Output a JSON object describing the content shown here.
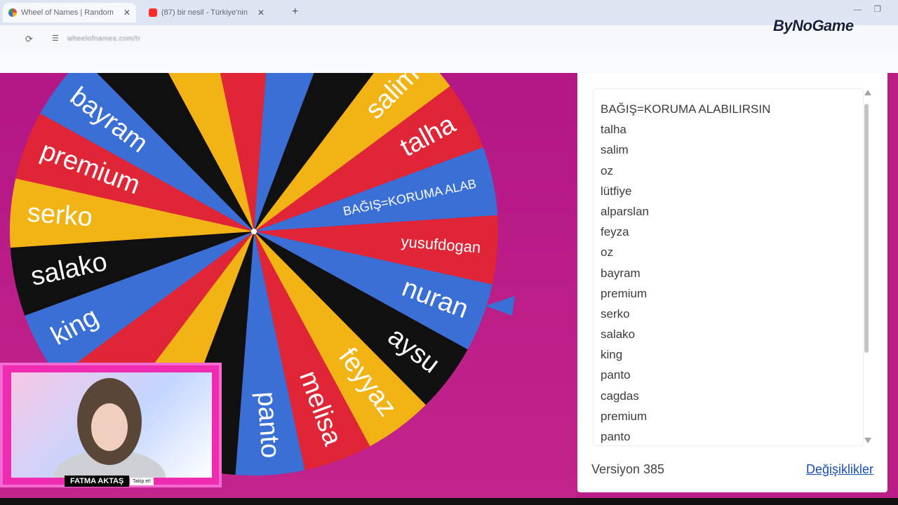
{
  "browser": {
    "tabs": [
      {
        "title": "Wheel of Names | Random",
        "favicon_color": "#e0454b"
      },
      {
        "title": "(87) bir nesil - Türkiye'nin",
        "favicon_color": "#ff2a2a"
      }
    ],
    "address": "wheelofnames.com/tr"
  },
  "logo": {
    "text": "ByNoGame"
  },
  "wheel": {
    "colors": {
      "blue": "#3a6fd6",
      "red": "#e02537",
      "yellow": "#f2b415",
      "black": "#101010"
    },
    "segments": [
      {
        "label": "BAĞIŞ=KORUMA ALAB",
        "color": "blue"
      },
      {
        "label": "yusufdogan",
        "color": "red"
      },
      {
        "label": "nuran",
        "color": "blue"
      },
      {
        "label": "aysu",
        "color": "black"
      },
      {
        "label": "feyyaz",
        "color": "yellow"
      },
      {
        "label": "melisa",
        "color": "red"
      },
      {
        "label": "panto",
        "color": "blue"
      },
      {
        "label": "",
        "color": "black"
      },
      {
        "label": "",
        "color": "yellow"
      },
      {
        "label": "",
        "color": "red"
      },
      {
        "label": "king",
        "color": "blue"
      },
      {
        "label": "salako",
        "color": "black"
      },
      {
        "label": "serko",
        "color": "yellow"
      },
      {
        "label": "premium",
        "color": "red"
      },
      {
        "label": "bayram",
        "color": "blue"
      },
      {
        "label": "",
        "color": "black"
      },
      {
        "label": "",
        "color": "yellow"
      },
      {
        "label": "",
        "color": "red"
      },
      {
        "label": "",
        "color": "blue"
      },
      {
        "label": "",
        "color": "black"
      },
      {
        "label": "salim",
        "color": "yellow"
      },
      {
        "label": "talha",
        "color": "red"
      }
    ]
  },
  "entries": {
    "items": [
      "BAĞIŞ=KORUMA ALABILIRSIN",
      "talha",
      "salim",
      "oz",
      "lütfiye",
      "alparslan",
      "feyza",
      "oz",
      "bayram",
      "premium",
      "serko",
      "salako",
      "king",
      "panto",
      "cagdas",
      "premium",
      "panto"
    ]
  },
  "footer": {
    "version": "Versiyon 385",
    "changes_link": "Değişiklikler"
  },
  "webcam": {
    "name": "FATMA AKTAŞ",
    "follow": "Takip et!"
  }
}
